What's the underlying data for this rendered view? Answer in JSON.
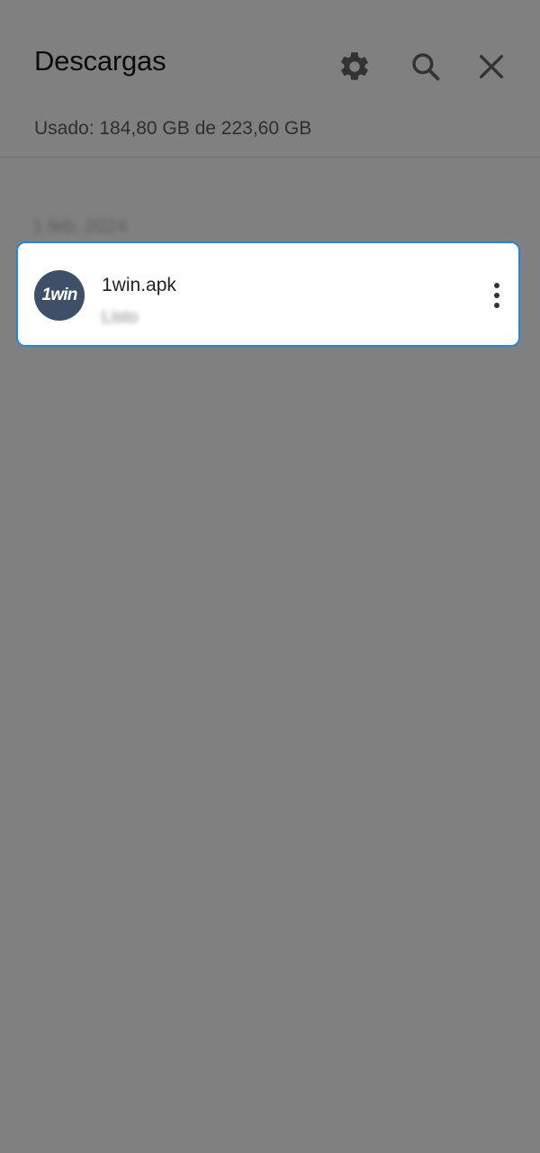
{
  "header": {
    "title": "Descargas",
    "icons": [
      "gear-icon",
      "search-icon",
      "close-icon"
    ]
  },
  "storage": {
    "text": "Usado: 184,80 GB de 223,60 GB"
  },
  "list": {
    "date_label": "1 feb. 2024",
    "items": [
      {
        "name": "1win.apk",
        "meta": "Listo",
        "icon_text": "1win",
        "icon_color": "#3e5068"
      }
    ]
  },
  "colors": {
    "background": "#808080",
    "card_border": "#1e88e5",
    "card_background": "#ffffff"
  }
}
